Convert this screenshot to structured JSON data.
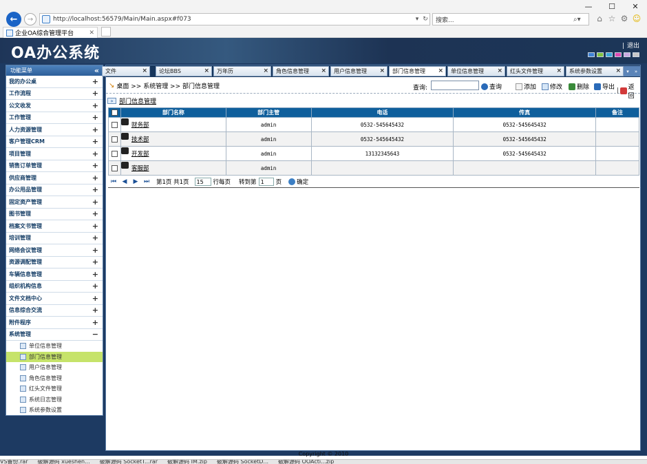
{
  "browser": {
    "url": "http://localhost:56579/Main/Main.aspx#f073",
    "url_host": "http://localhost",
    "url_rest": ":56579/Main/Main.aspx#f073",
    "search_placeholder": "搜索...",
    "tab_title": "企业OA综合管理平台"
  },
  "header": {
    "logo": "OA办公系统",
    "logout": "退出",
    "swatches": [
      "#3f83d6",
      "#82c341",
      "#3aa7d8",
      "#e04bb3",
      "#c9a9e0",
      "#c8c8c8"
    ]
  },
  "sidebar": {
    "title": "功能菜单",
    "collapse_icon": "«",
    "items": [
      {
        "label": "我的办公桌",
        "toggle": "+"
      },
      {
        "label": "工作流程",
        "toggle": "+"
      },
      {
        "label": "公文收发",
        "toggle": "+"
      },
      {
        "label": "工作管理",
        "toggle": "+"
      },
      {
        "label": "人力资源管理",
        "toggle": "+"
      },
      {
        "label": "客户管理CRM",
        "toggle": "+"
      },
      {
        "label": "项目管理",
        "toggle": "+"
      },
      {
        "label": "销售订单管理",
        "toggle": "+"
      },
      {
        "label": "供应商管理",
        "toggle": "+"
      },
      {
        "label": "办公用品管理",
        "toggle": "+"
      },
      {
        "label": "固定资产管理",
        "toggle": "+"
      },
      {
        "label": "图书管理",
        "toggle": "+"
      },
      {
        "label": "档案文书管理",
        "toggle": "+"
      },
      {
        "label": "培训管理",
        "toggle": "+"
      },
      {
        "label": "网络会议管理",
        "toggle": "+"
      },
      {
        "label": "资源调配管理",
        "toggle": "+"
      },
      {
        "label": "车辆信息管理",
        "toggle": "+"
      },
      {
        "label": "组织机构信息",
        "toggle": "+"
      },
      {
        "label": "文件文档中心",
        "toggle": "+"
      },
      {
        "label": "信息综合交流",
        "toggle": "+"
      },
      {
        "label": "附件程序",
        "toggle": "+"
      },
      {
        "label": "系统管理",
        "toggle": "−"
      }
    ],
    "sub_items": [
      {
        "label": "单位信息管理",
        "active": false
      },
      {
        "label": "部门信息管理",
        "active": true
      },
      {
        "label": "用户信息管理",
        "active": false
      },
      {
        "label": "角色信息管理",
        "active": false
      },
      {
        "label": "红头文件管理",
        "active": false
      },
      {
        "label": "系统日志管理",
        "active": false
      },
      {
        "label": "系统参数设置",
        "active": false
      }
    ]
  },
  "tabs": [
    {
      "label": "文件"
    },
    {
      "label": "论坛BBS"
    },
    {
      "label": "万年历"
    },
    {
      "label": "角色信息管理"
    },
    {
      "label": "用户信息管理"
    },
    {
      "label": "部门信息管理",
      "active": true
    },
    {
      "label": "单位信息管理"
    },
    {
      "label": "红头文件管理"
    },
    {
      "label": "系统参数设置"
    }
  ],
  "breadcrumb": "桌面 >> 系统管理 >> 部门信息管理",
  "toolbar": {
    "query_label": "查询:",
    "search_btn": "查询",
    "add": "添加",
    "edit": "修改",
    "delete": "删除",
    "export": "导出",
    "back": "返回"
  },
  "section_title": "部门信息管理",
  "table": {
    "headers": [
      "部门名称",
      "部门主管",
      "电话",
      "传真",
      "备注"
    ],
    "rows": [
      {
        "name": "财务部",
        "manager": "admin",
        "phone": "0532-545645432",
        "fax": "0532-545645432",
        "note": ""
      },
      {
        "name": "技术部",
        "manager": "admin",
        "phone": "0532-545645432",
        "fax": "0532-545645432",
        "note": ""
      },
      {
        "name": "开发部",
        "manager": "admin",
        "phone": "13132345643",
        "fax": "0532-545645432",
        "note": ""
      },
      {
        "name": "客服部",
        "manager": "admin",
        "phone": "",
        "fax": "",
        "note": ""
      }
    ]
  },
  "pager": {
    "page_info": "第1页  共1页",
    "page_size": "15",
    "per_page_label": "行每页",
    "goto_label": "转到第",
    "goto_value": "1",
    "page_suffix": "页",
    "confirm": "确定"
  },
  "footer": "Copyright © 2010",
  "taskbar": [
    "VS备份.rar",
    "破解源码 xueshen...",
    "破解源码 SocketT...rar",
    "破解源码 IM.zip",
    "破解源码 SocketD...",
    "破解源码 OOActi...zip"
  ]
}
